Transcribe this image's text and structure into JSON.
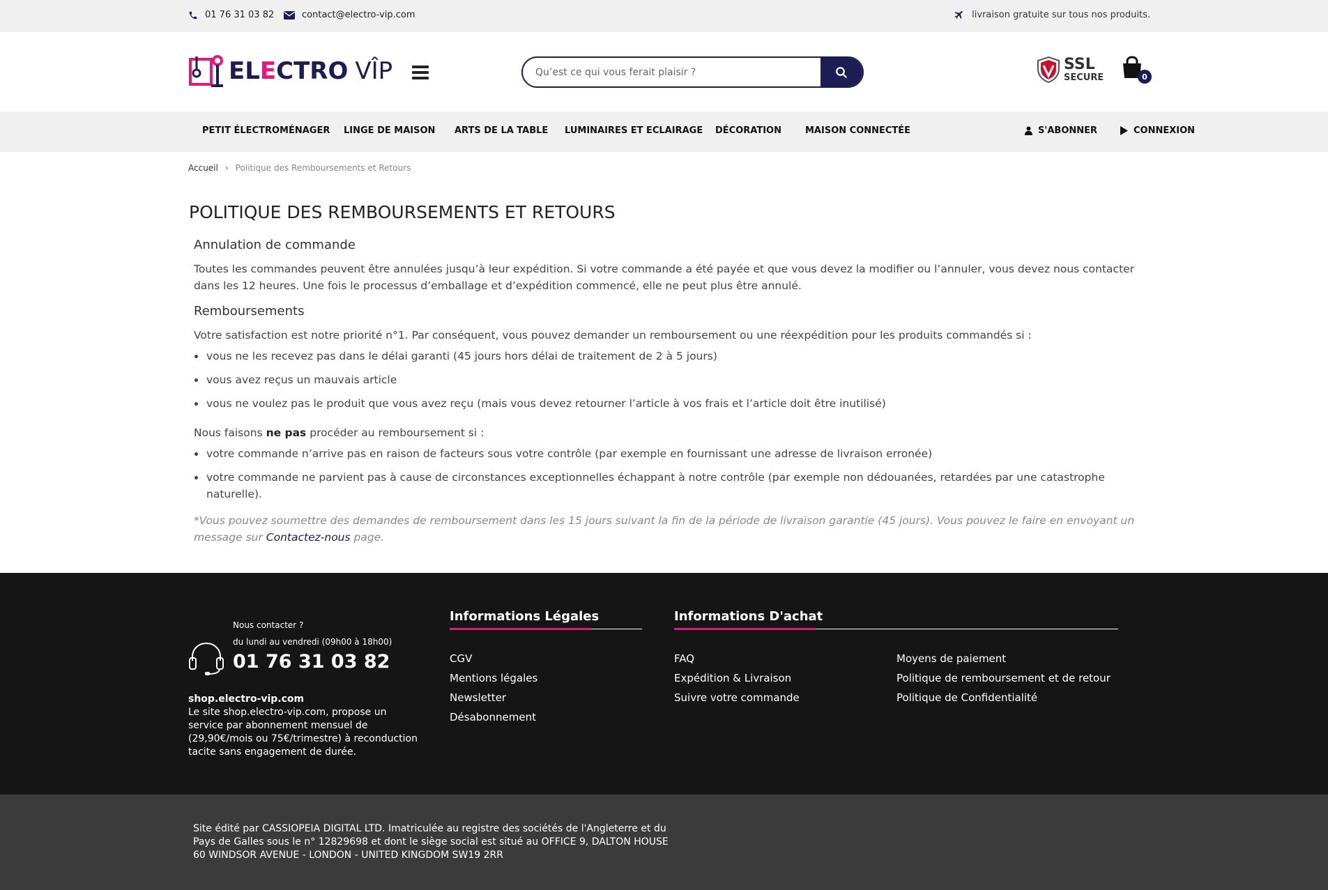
{
  "topbar": {
    "phone": "01 76 31 03 82",
    "email": "contact@electro-vip.com",
    "shipping": "livraison gratuite sur tous nos produits."
  },
  "header": {
    "logo_part1": "EL",
    "logo_part2": "E",
    "logo_part3": "CTRO",
    "logo_part4": "VÎP",
    "search_placeholder": "Qu’est ce qui vous ferait plaisir ?",
    "ssl_big": "SSL",
    "ssl_small": "SECURE",
    "cart_count": "0"
  },
  "nav": {
    "items": [
      "PETIT ÉLECTROMÉNAGER",
      "LINGE DE MAISON",
      "ARTS DE LA TABLE",
      "LUMINAIRES ET ECLAIRAGE",
      "DÉCORATION",
      "MAISON CONNECTÉE"
    ],
    "subscribe": "S'ABONNER",
    "login": "CONNEXION"
  },
  "breadcrumb": {
    "home": "Accueil",
    "sep": "›",
    "current": "Politique des Remboursements et Retours"
  },
  "content": {
    "title": "POLITIQUE DES REMBOURSEMENTS ET RETOURS",
    "section1_title": "Annulation de commande",
    "section1_text": "Toutes les commandes peuvent être annulées jusqu’à leur expédition. Si votre commande a été payée et que vous devez la modifier ou l’annuler, vous devez nous contacter dans les 12 heures. Une fois le processus d’emballage et d’expédition commencé, elle ne peut plus être annulé.",
    "section2_title": "Remboursements",
    "section2_intro": "Votre satisfaction est notre priorité n°1. Par conséquent, vous pouvez demander un remboursement ou une réexpédition pour les produits commandés si :",
    "list1": [
      "vous ne les recevez pas dans le délai garanti (45 jours hors délai de traitement de 2 à 5 jours)",
      "vous avez reçus un mauvais article",
      "vous ne voulez pas le produit que vous avez reçu (mais vous devez retourner l’article à vos frais et l’article doit être inutilisé)"
    ],
    "no_refund_pre": "Nous faisons ",
    "no_refund_bold": "ne pas",
    "no_refund_post": " procéder au remboursement si :",
    "list2": [
      "votre commande n’arrive pas en raison de facteurs sous votre contrôle (par exemple en fournissant une adresse de livraison erronée)",
      "votre commande ne parvient pas à cause de circonstances exceptionnelles échappant à notre contrôle (par exemple non dédouanées, retardées par une catastrophe naturelle)."
    ],
    "note_pre": "*Vous pouvez soumettre des demandes de remboursement dans les 15 jours suivant la fin de la période de livraison garantie (45 jours). Vous pouvez le faire en envoyant un message sur ",
    "note_link": "Contactez-nous",
    "note_post": " page."
  },
  "footer": {
    "contact_label": "Nous contacter ?",
    "contact_hours": "du lundi au vendredi (09h00 à 18h00)",
    "contact_phone": "01 76 31 03 82",
    "site_name": "shop.electro-vip.com",
    "site_desc": "Le site shop.electro-vip.com, propose un service par abonnement mensuel de (29,90€/mois ou 75€/trimestre) à reconduction tacite sans engagement de durée.",
    "legal_title": "Informations Légales",
    "legal_links": [
      "CGV",
      "Mentions légales",
      "Newsletter",
      "Désabonnement"
    ],
    "purchase_title": "Informations D'achat",
    "purchase_col1": [
      "FAQ",
      "Expédition & Livraison",
      "Suivre votre commande"
    ],
    "purchase_col2": [
      "Moyens de paiement",
      "Politique de remboursement et de retour",
      "Politique de Confidentialité"
    ],
    "bottom_text": "Site édité par CASSIOPEIA DIGITAL LTD. Imatriculée au registre des sociétés de l'Angleterre et du Pays de Galles sous le n° 12829698 et dont le siège social est situé au OFFICE 9, DALTON HOUSE 60 WINDSOR AVENUE - LONDON - UNITED KINGDOM SW19 2RR"
  },
  "colors": {
    "brand_navy": "#1d1d55",
    "brand_pink": "#e5177e",
    "footer_bg": "#151515",
    "bottom_bg": "#3b3b3b"
  }
}
